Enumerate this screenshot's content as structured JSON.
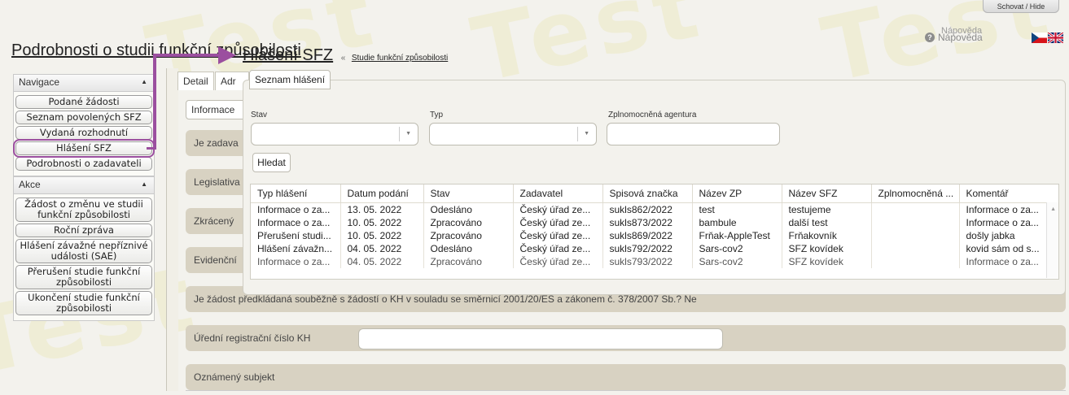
{
  "top": {
    "hide_label": "Schovat / Hide",
    "help_ghost": "Nápověda",
    "help_label": "Nápověda"
  },
  "page": {
    "title": "Podrobnosti o studii funkční způsobilosti"
  },
  "watermark": "Test",
  "nav": {
    "nav_header": "Navigace",
    "nav_items": [
      "Podané žádosti",
      "Seznam povolených SFZ",
      "Vydaná rozhodnutí",
      "Hlášení SFZ",
      "Podrobnosti o zadavateli"
    ],
    "actions_header": "Akce",
    "action_items": [
      "Žádost o změnu ve studii funkční způsobilosti",
      "Roční zpráva",
      "Hlášení závažné nepříznivé události (SAE)",
      "Přerušení studie funkční způsobilosti",
      "Ukončení studie funkční způsobilosti"
    ]
  },
  "main": {
    "tabs": [
      "Detail",
      "Adr"
    ],
    "subtab": "Informace",
    "sections": [
      "Je zadava",
      "Legislativa",
      "Zkrácený",
      "Evidenční"
    ],
    "question": "Je žádost předkládaná souběžně s žádostí o KH v souladu se směrnicí 2001/20/ES a zákonem č. 378/2007 Sb.?  Ne",
    "reg_label": "Úřední registrační číslo KH",
    "notified_label": "Oznámený subjekt"
  },
  "dialog": {
    "title": "Hlášení SFZ",
    "sep": "«",
    "breadcrumb": "Studie funkční způsobilosti",
    "tab": "Seznam hlášení",
    "filters": {
      "stav": "Stav",
      "typ": "Typ",
      "agency": "Zplnomocněná agentura"
    },
    "search": "Hledat",
    "columns": [
      "Typ hlášení",
      "Datum podání",
      "Stav",
      "Zadavatel",
      "Spisová značka",
      "Název ZP",
      "Název SFZ",
      "Zplnomocněná ...",
      "Komentář"
    ],
    "rows": [
      [
        "Informace o za...",
        "13. 05. 2022",
        "Odesláno",
        "Český úřad ze...",
        "sukls862/2022",
        "test",
        "testujeme",
        "",
        "Informace o za..."
      ],
      [
        "Informace o za...",
        "10. 05. 2022",
        "Zpracováno",
        "Český úřad ze...",
        "sukls873/2022",
        "bambule",
        "další test",
        "",
        "Informace o za..."
      ],
      [
        "Přerušení studi...",
        "10. 05. 2022",
        "Zpracováno",
        "Český úřad ze...",
        "sukls869/2022",
        "Frňak-AppleTest",
        "Frňakovník",
        "",
        "došly jabka"
      ],
      [
        "Hlášení závažn...",
        "04. 05. 2022",
        "Odesláno",
        "Český úřad ze...",
        "sukls792/2022",
        "Sars-cov2",
        "SFZ kovídek",
        "",
        "kovid sám od s..."
      ],
      [
        "Informace o za...",
        "04. 05. 2022",
        "Zpracováno",
        "Český úřad ze...",
        "sukls793/2022",
        "Sars-cov2",
        "SFZ kovídek",
        "",
        "Informace o za..."
      ]
    ]
  }
}
